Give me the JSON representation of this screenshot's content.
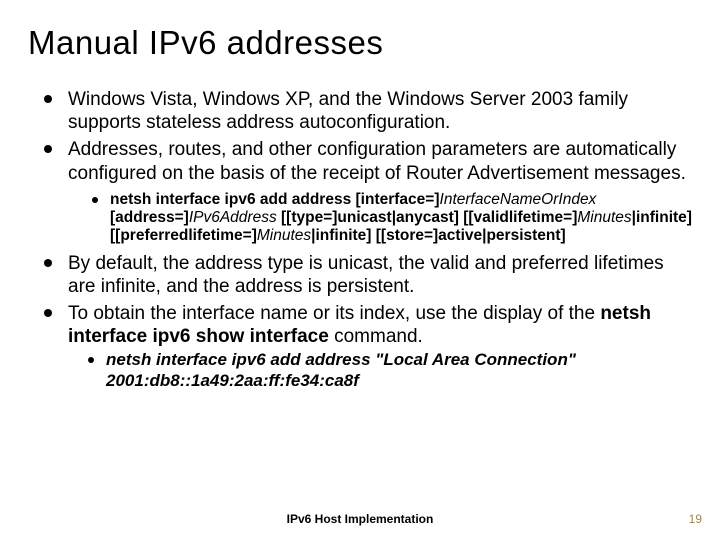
{
  "title": "Manual IPv6 addresses",
  "bullets": {
    "b1": "Windows Vista, Windows XP, and the Windows Server 2003 family supports stateless address autoconfiguration.",
    "b2": "Addresses, routes, and other configuration parameters are automatically configured on the basis of the receipt of Router Advertisement messages.",
    "b3": "By default, the address type is unicast, the valid and preferred lifetimes are infinite, and the address is persistent.",
    "b4_pre": "To obtain the interface name or its index, use the display of the ",
    "b4_cmd": "netsh interface ipv6 show interface",
    "b4_post": " command."
  },
  "cmd": {
    "c1": "netsh interface ipv6 add address ",
    "c2": "[interface=]",
    "c3": "InterfaceNameOrIndex",
    "c4": " [address=]",
    "c5": "IPv6Address",
    "c6": " [[type=]unicast|anycast] [[validlifetime=]",
    "c7": "Minutes",
    "c8": "|infinite] [[preferredlifetime=]",
    "c9": "Minutes",
    "c10": "|infinite] [[store=]active|persistent]"
  },
  "example": "netsh interface ipv6 add address \"Local Area Connection\" 2001:db8::1a49:2aa:ff:fe34:ca8f",
  "footer": "IPv6 Host Implementation",
  "page": "19"
}
